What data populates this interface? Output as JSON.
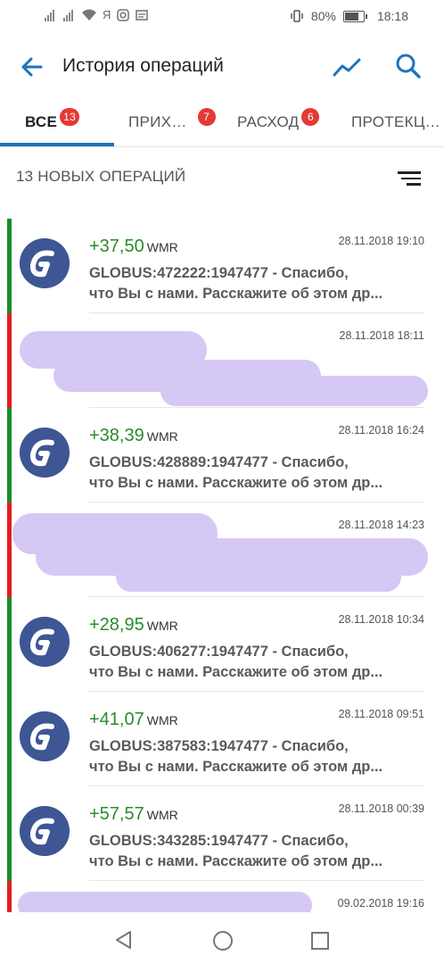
{
  "status": {
    "carrier_glyph": "Я",
    "battery": "80%",
    "battery_level": 0.8,
    "time": "18:18"
  },
  "appbar": {
    "title": "История операций"
  },
  "tabs": [
    {
      "label": "ВСЕ",
      "badge": "13"
    },
    {
      "label": "ПРИХ…",
      "badge": "7"
    },
    {
      "label": "РАСХОД",
      "badge": "6"
    },
    {
      "label": "ПРОТЕКЦ…"
    }
  ],
  "subheader": "13 НОВЫХ ОПЕРАЦИЙ",
  "transactions": [
    {
      "amount": "+37,50",
      "currency": "WMR",
      "date": "28.11.2018 19:10",
      "line1": "GLOBUS:472222:1947477 - Спасибо,",
      "line2": "что Вы с нами. Расскажите об этом др..."
    },
    {
      "date": "28.11.2018 18:11"
    },
    {
      "amount": "+38,39",
      "currency": "WMR",
      "date": "28.11.2018 16:24",
      "line1": "GLOBUS:428889:1947477 - Спасибо,",
      "line2": "что Вы с нами. Расскажите об этом др..."
    },
    {
      "date": "28.11.2018 14:23"
    },
    {
      "amount": "+28,95",
      "currency": "WMR",
      "date": "28.11.2018 10:34",
      "line1": "GLOBUS:406277:1947477 - Спасибо,",
      "line2": "что Вы с нами. Расскажите об этом др..."
    },
    {
      "amount": "+41,07",
      "currency": "WMR",
      "date": "28.11.2018 09:51",
      "line1": "GLOBUS:387583:1947477 - Спасибо,",
      "line2": "что Вы с нами. Расскажите об этом др..."
    },
    {
      "amount": "+57,57",
      "currency": "WMR",
      "date": "28.11.2018 00:39",
      "line1": "GLOBUS:343285:1947477 - Спасибо,",
      "line2": "что Вы с нами. Расскажите об этом др..."
    },
    {
      "date": "09.02.2018 19:16"
    }
  ],
  "colors": {
    "accent": "#1e73be",
    "income": "#1a8f24",
    "expense": "#e21f1f",
    "badge": "#e53935",
    "avatar": "#3e5694",
    "redaction": "#d6c8f4"
  }
}
